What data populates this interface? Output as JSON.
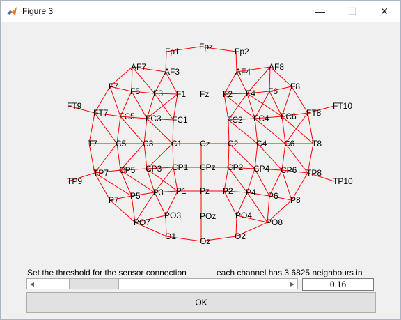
{
  "window": {
    "title": "Figure 3",
    "minimize_glyph": "—",
    "maximize_glyph": "☐",
    "close_glyph": "✕",
    "app_icon": "matlab-icon"
  },
  "layout_plot": {
    "edge_color": "#ff0000",
    "label_color": "#000000",
    "sensors": [
      {
        "name": "Fpz"
      },
      {
        "name": "Fp1"
      },
      {
        "name": "Fp2"
      },
      {
        "name": "AF7"
      },
      {
        "name": "AF3"
      },
      {
        "name": "AF4"
      },
      {
        "name": "AF8"
      },
      {
        "name": "F7"
      },
      {
        "name": "F5"
      },
      {
        "name": "F3"
      },
      {
        "name": "F1"
      },
      {
        "name": "Fz"
      },
      {
        "name": "F2"
      },
      {
        "name": "F4"
      },
      {
        "name": "F6"
      },
      {
        "name": "F8"
      },
      {
        "name": "FT9"
      },
      {
        "name": "FT7"
      },
      {
        "name": "FC5"
      },
      {
        "name": "FC3"
      },
      {
        "name": "FC1"
      },
      {
        "name": "FC2"
      },
      {
        "name": "FC4"
      },
      {
        "name": "FC6"
      },
      {
        "name": "FT8"
      },
      {
        "name": "FT10"
      },
      {
        "name": "T7"
      },
      {
        "name": "C5"
      },
      {
        "name": "C3"
      },
      {
        "name": "C1"
      },
      {
        "name": "Cz"
      },
      {
        "name": "C2"
      },
      {
        "name": "C4"
      },
      {
        "name": "C6"
      },
      {
        "name": "T8"
      },
      {
        "name": "TP9"
      },
      {
        "name": "TP7"
      },
      {
        "name": "CP5"
      },
      {
        "name": "CP3"
      },
      {
        "name": "CP1"
      },
      {
        "name": "CPz"
      },
      {
        "name": "CP2"
      },
      {
        "name": "CP4"
      },
      {
        "name": "CP6"
      },
      {
        "name": "TP8"
      },
      {
        "name": "TP10"
      },
      {
        "name": "P7"
      },
      {
        "name": "P5"
      },
      {
        "name": "P3"
      },
      {
        "name": "P1"
      },
      {
        "name": "Pz"
      },
      {
        "name": "P2"
      },
      {
        "name": "P4"
      },
      {
        "name": "P6"
      },
      {
        "name": "P8"
      },
      {
        "name": "PO7"
      },
      {
        "name": "PO3"
      },
      {
        "name": "POz"
      },
      {
        "name": "PO4"
      },
      {
        "name": "PO8"
      },
      {
        "name": "O1"
      },
      {
        "name": "Oz"
      },
      {
        "name": "O2"
      }
    ],
    "edges": [
      [
        "Fp1",
        "Fpz"
      ],
      [
        "Fpz",
        "Fp2"
      ],
      [
        "Fp1",
        "AF3"
      ],
      [
        "Fp2",
        "AF4"
      ],
      [
        "AF7",
        "AF3"
      ],
      [
        "AF4",
        "AF8"
      ],
      [
        "AF7",
        "F7"
      ],
      [
        "AF7",
        "F5"
      ],
      [
        "AF7",
        "F3"
      ],
      [
        "AF3",
        "F3"
      ],
      [
        "AF3",
        "F1"
      ],
      [
        "AF4",
        "F2"
      ],
      [
        "AF4",
        "F4"
      ],
      [
        "AF8",
        "F4"
      ],
      [
        "AF8",
        "F6"
      ],
      [
        "AF8",
        "F8"
      ],
      [
        "F7",
        "F5"
      ],
      [
        "F5",
        "F3"
      ],
      [
        "F3",
        "F1"
      ],
      [
        "F2",
        "F4"
      ],
      [
        "F4",
        "F6"
      ],
      [
        "F6",
        "F8"
      ],
      [
        "F7",
        "FT7"
      ],
      [
        "F7",
        "FC5"
      ],
      [
        "F5",
        "FC5"
      ],
      [
        "F5",
        "FC3"
      ],
      [
        "F3",
        "FC3"
      ],
      [
        "F3",
        "FC1"
      ],
      [
        "F1",
        "FC1"
      ],
      [
        "F1",
        "FC3"
      ],
      [
        "F2",
        "FC2"
      ],
      [
        "F2",
        "FC4"
      ],
      [
        "F4",
        "FC2"
      ],
      [
        "F4",
        "FC4"
      ],
      [
        "F4",
        "FC6"
      ],
      [
        "F6",
        "FC4"
      ],
      [
        "F6",
        "FC6"
      ],
      [
        "F8",
        "FC6"
      ],
      [
        "F8",
        "FT8"
      ],
      [
        "FT9",
        "FT7"
      ],
      [
        "FT8",
        "FT10"
      ],
      [
        "FT7",
        "FC5"
      ],
      [
        "FC5",
        "FC3"
      ],
      [
        "FC3",
        "FC1"
      ],
      [
        "FC2",
        "FC4"
      ],
      [
        "FC4",
        "FC6"
      ],
      [
        "FC6",
        "FT8"
      ],
      [
        "FT7",
        "T7"
      ],
      [
        "FT7",
        "C5"
      ],
      [
        "FC5",
        "C5"
      ],
      [
        "FC5",
        "C3"
      ],
      [
        "FC3",
        "C3"
      ],
      [
        "FC3",
        "C1"
      ],
      [
        "FC1",
        "C1"
      ],
      [
        "FC2",
        "C2"
      ],
      [
        "FC2",
        "C4"
      ],
      [
        "FC4",
        "C4"
      ],
      [
        "FC4",
        "C6"
      ],
      [
        "FC6",
        "C6"
      ],
      [
        "FC6",
        "T8"
      ],
      [
        "FT8",
        "T8"
      ],
      [
        "FT8",
        "C6"
      ],
      [
        "T7",
        "C5"
      ],
      [
        "C5",
        "C3"
      ],
      [
        "C3",
        "C1"
      ],
      [
        "C1",
        "Cz"
      ],
      [
        "Cz",
        "C2"
      ],
      [
        "C2",
        "C4"
      ],
      [
        "C4",
        "C6"
      ],
      [
        "C6",
        "T8"
      ],
      [
        "T7",
        "TP7"
      ],
      [
        "C5",
        "TP7"
      ],
      [
        "C5",
        "CP5"
      ],
      [
        "C3",
        "CP5"
      ],
      [
        "C3",
        "CP3"
      ],
      [
        "C1",
        "CP3"
      ],
      [
        "C1",
        "CP1"
      ],
      [
        "Cz",
        "CPz"
      ],
      [
        "C2",
        "CP2"
      ],
      [
        "C2",
        "CP4"
      ],
      [
        "C4",
        "CP4"
      ],
      [
        "C4",
        "CP6"
      ],
      [
        "C6",
        "CP6"
      ],
      [
        "C6",
        "TP8"
      ],
      [
        "T8",
        "TP8"
      ],
      [
        "TP9",
        "TP7"
      ],
      [
        "TP8",
        "TP10"
      ],
      [
        "TP7",
        "CP5"
      ],
      [
        "CP5",
        "CP3"
      ],
      [
        "CP3",
        "CP1"
      ],
      [
        "CP1",
        "CPz"
      ],
      [
        "CPz",
        "CP2"
      ],
      [
        "CP2",
        "CP4"
      ],
      [
        "CP4",
        "CP6"
      ],
      [
        "CP6",
        "TP8"
      ],
      [
        "TP7",
        "P7"
      ],
      [
        "TP7",
        "P5"
      ],
      [
        "CP5",
        "P5"
      ],
      [
        "CP5",
        "P3"
      ],
      [
        "CP3",
        "P3"
      ],
      [
        "CP3",
        "P1"
      ],
      [
        "CP1",
        "P1"
      ],
      [
        "CP1",
        "P3"
      ],
      [
        "CPz",
        "Pz"
      ],
      [
        "CP2",
        "P2"
      ],
      [
        "CP2",
        "P4"
      ],
      [
        "CP4",
        "P4"
      ],
      [
        "CP4",
        "P6"
      ],
      [
        "CP6",
        "P6"
      ],
      [
        "CP6",
        "P8"
      ],
      [
        "TP8",
        "P8"
      ],
      [
        "P7",
        "P5"
      ],
      [
        "P5",
        "P3"
      ],
      [
        "P3",
        "P1"
      ],
      [
        "P1",
        "Pz"
      ],
      [
        "Pz",
        "P2"
      ],
      [
        "P2",
        "P4"
      ],
      [
        "P4",
        "P6"
      ],
      [
        "P6",
        "P8"
      ],
      [
        "P7",
        "PO7"
      ],
      [
        "P5",
        "PO7"
      ],
      [
        "P3",
        "PO7"
      ],
      [
        "P3",
        "PO3"
      ],
      [
        "P1",
        "PO3"
      ],
      [
        "P2",
        "PO4"
      ],
      [
        "P4",
        "PO4"
      ],
      [
        "P4",
        "PO8"
      ],
      [
        "P6",
        "PO8"
      ],
      [
        "P8",
        "PO8"
      ],
      [
        "PO7",
        "PO3"
      ],
      [
        "PO4",
        "PO8"
      ],
      [
        "PO7",
        "O1"
      ],
      [
        "PO3",
        "O1"
      ],
      [
        "POz",
        "Oz"
      ],
      [
        "PO4",
        "O2"
      ],
      [
        "PO8",
        "O2"
      ],
      [
        "O1",
        "Oz"
      ],
      [
        "Oz",
        "O2"
      ],
      [
        "Pz",
        "POz"
      ]
    ]
  },
  "controls": {
    "threshold_label": "Set the threshold for the sensor connection",
    "neighbour_text": "each channel has 3.6825 neighbours in",
    "slider_left_arrow": "◀",
    "slider_right_arrow": "▶",
    "slider_value_fraction": 0.16,
    "threshold_value": "0.16",
    "ok_label": "OK"
  }
}
